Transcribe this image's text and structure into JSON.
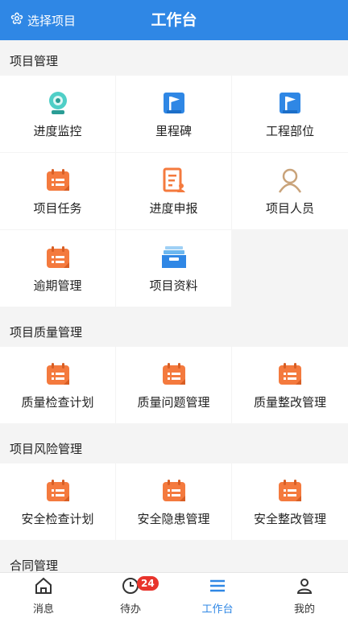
{
  "header": {
    "select_label": "选择项目",
    "title": "工作台"
  },
  "sections": [
    {
      "title": "项目管理",
      "items": [
        {
          "label": "进度监控",
          "icon": "camera-icon"
        },
        {
          "label": "里程碑",
          "icon": "flag-icon"
        },
        {
          "label": "工程部位",
          "icon": "flag-icon"
        },
        {
          "label": "项目任务",
          "icon": "calendar-icon"
        },
        {
          "label": "进度申报",
          "icon": "report-icon"
        },
        {
          "label": "项目人员",
          "icon": "person-icon"
        },
        {
          "label": "逾期管理",
          "icon": "calendar-icon"
        },
        {
          "label": "项目资料",
          "icon": "tray-icon"
        }
      ]
    },
    {
      "title": "项目质量管理",
      "items": [
        {
          "label": "质量检查计划",
          "icon": "calendar-icon"
        },
        {
          "label": "质量问题管理",
          "icon": "calendar-icon"
        },
        {
          "label": "质量整改管理",
          "icon": "calendar-icon"
        }
      ]
    },
    {
      "title": "项目风险管理",
      "items": [
        {
          "label": "安全检查计划",
          "icon": "calendar-icon"
        },
        {
          "label": "安全隐患管理",
          "icon": "calendar-icon"
        },
        {
          "label": "安全整改管理",
          "icon": "calendar-icon"
        }
      ]
    },
    {
      "title": "合同管理",
      "items": []
    }
  ],
  "tabbar": {
    "items": [
      {
        "label": "消息",
        "icon": "home-icon"
      },
      {
        "label": "待办",
        "icon": "clock-icon",
        "badge": "24"
      },
      {
        "label": "工作台",
        "icon": "menu-icon",
        "active": true
      },
      {
        "label": "我的",
        "icon": "user-icon"
      }
    ]
  },
  "colors": {
    "primary": "#2f87e5",
    "orange": "#f47a3e",
    "badge": "#e8342c",
    "teal": "#4fcfc7",
    "tan": "#c9a37a"
  }
}
